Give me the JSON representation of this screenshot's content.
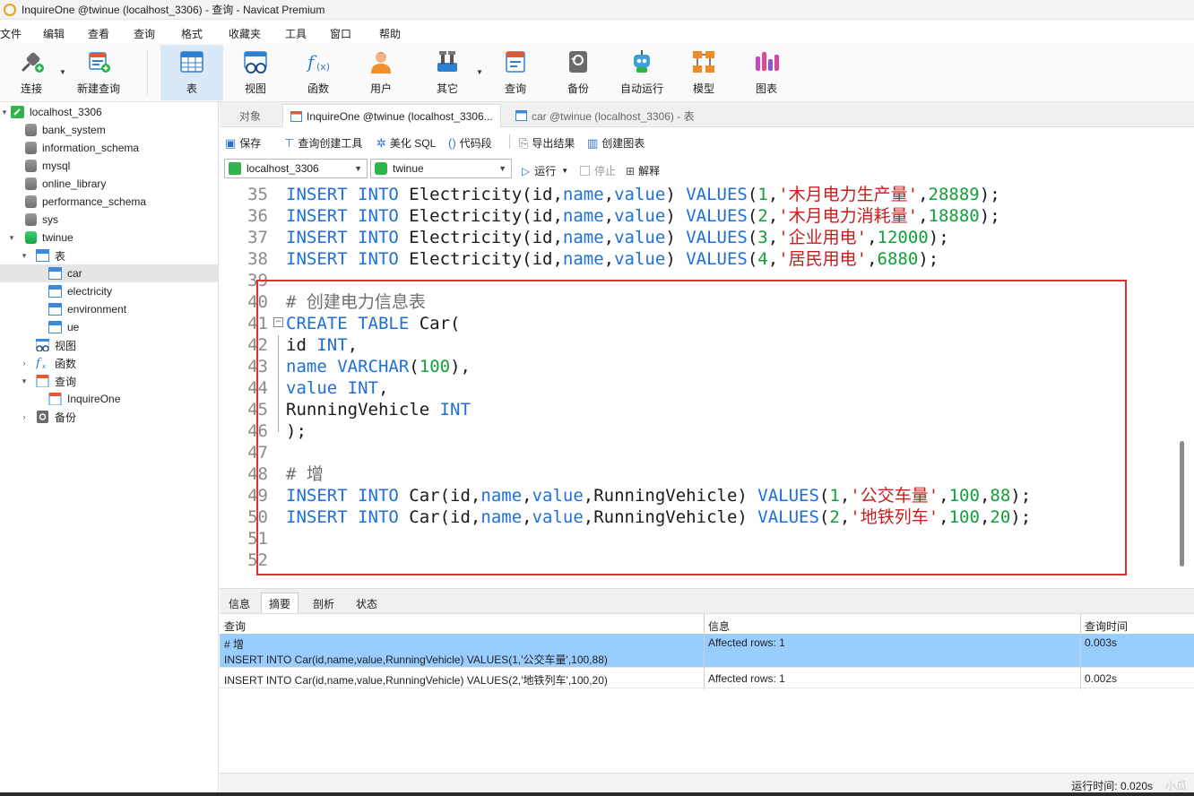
{
  "window": {
    "title": "InquireOne @twinue (localhost_3306) - 查询 - Navicat Premium"
  },
  "menu": [
    "文件",
    "编辑",
    "查看",
    "查询",
    "格式",
    "收藏夹",
    "工具",
    "窗口",
    "帮助"
  ],
  "toolbar": {
    "items": [
      "连接",
      "新建查询",
      "表",
      "视图",
      "函数",
      "用户",
      "其它",
      "查询",
      "备份",
      "自动运行",
      "模型",
      "图表"
    ],
    "active": "表"
  },
  "tree": {
    "connection": "localhost_3306",
    "databases": [
      "bank_system",
      "information_schema",
      "mysql",
      "online_library",
      "performance_schema",
      "sys"
    ],
    "open_db": "twinue",
    "tables_label": "表",
    "tables": [
      "car",
      "electricity",
      "environment",
      "ue"
    ],
    "selected_table": "car",
    "views_label": "视图",
    "functions_label": "函数",
    "queries_label": "查询",
    "query_item": "InquireOne",
    "backup_label": "备份"
  },
  "tabs": {
    "objects": "对象",
    "query_tab": "InquireOne @twinue (localhost_3306...",
    "table_tab": "car @twinue (localhost_3306) - 表"
  },
  "editor_toolbar": {
    "save": "保存",
    "query_builder": "查询创建工具",
    "beautify": "美化 SQL",
    "snippet": "代码段",
    "export": "导出结果",
    "create_chart": "创建图表"
  },
  "connection_bar": {
    "connection": "localhost_3306",
    "database": "twinue",
    "run": "运行",
    "stop": "停止",
    "explain": "解释"
  },
  "code": [
    {
      "n": "35",
      "t": "INSERT INTO Electricity(id,name,value) VALUES(1,'木月电力生产量',28889);"
    },
    {
      "n": "36",
      "t": "INSERT INTO Electricity(id,name,value) VALUES(2,'木月电力消耗量',18880);"
    },
    {
      "n": "37",
      "t": "INSERT INTO Electricity(id,name,value) VALUES(3,'企业用电',12000);"
    },
    {
      "n": "38",
      "t": "INSERT INTO Electricity(id,name,value) VALUES(4,'居民用电',6880);"
    },
    {
      "n": "39",
      "t": ""
    },
    {
      "n": "40",
      "t": "# 创建电力信息表"
    },
    {
      "n": "41",
      "t": "CREATE TABLE Car("
    },
    {
      "n": "42",
      "t": "id INT,"
    },
    {
      "n": "43",
      "t": "name VARCHAR(100),"
    },
    {
      "n": "44",
      "t": "value INT,"
    },
    {
      "n": "45",
      "t": "RunningVehicle INT"
    },
    {
      "n": "46",
      "t": ");"
    },
    {
      "n": "47",
      "t": ""
    },
    {
      "n": "48",
      "t": "# 增"
    },
    {
      "n": "49",
      "t": "INSERT INTO Car(id,name,value,RunningVehicle) VALUES(1,'公交车量',100,88);"
    },
    {
      "n": "50",
      "t": "INSERT INTO Car(id,name,value,RunningVehicle) VALUES(2,'地铁列车',100,20);"
    },
    {
      "n": "51",
      "t": ""
    },
    {
      "n": "52",
      "t": ""
    }
  ],
  "bottom_tabs": [
    "信息",
    "摘要",
    "剖析",
    "状态"
  ],
  "bottom_active": "摘要",
  "results": {
    "headers": [
      "查询",
      "信息",
      "查询时间"
    ],
    "rows": [
      {
        "query_line1": "# 增",
        "query_line2": "INSERT INTO Car(id,name,value,RunningVehicle) VALUES(1,'公交车量',100,88)",
        "info": "Affected rows: 1",
        "time": "0.003s"
      },
      {
        "query_line1": "INSERT INTO Car(id,name,value,RunningVehicle) VALUES(2,'地铁列车',100,20)",
        "info": "Affected rows: 1",
        "time": "0.002s"
      }
    ]
  },
  "status": {
    "run_time": "运行时间: 0.020s",
    "watermark": "小瓜"
  }
}
